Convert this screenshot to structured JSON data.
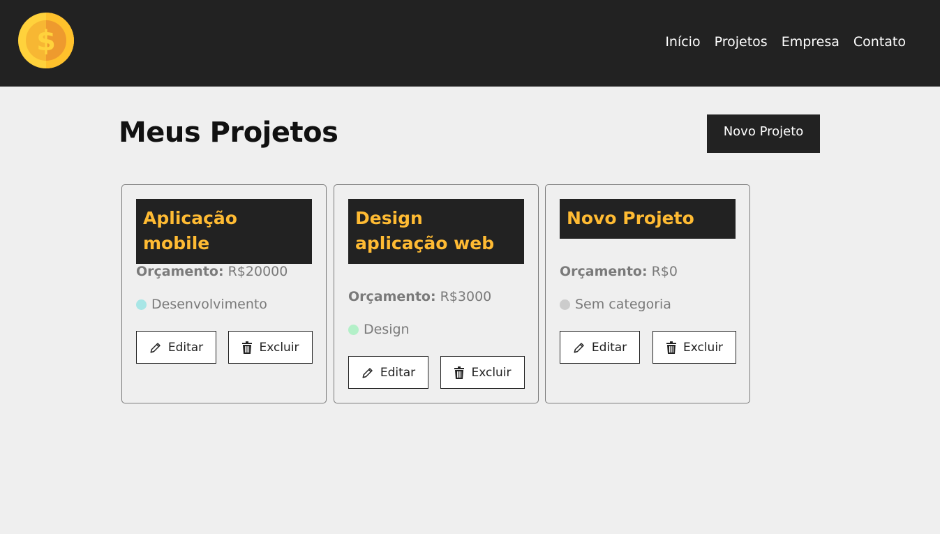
{
  "navbar": {
    "links": [
      "Início",
      "Projetos",
      "Empresa",
      "Contato"
    ]
  },
  "main": {
    "title": "Meus Projetos",
    "new_project_label": "Novo Projeto"
  },
  "projects": [
    {
      "name": "Aplicação mobile",
      "budget_label": "Orçamento:",
      "budget_value": "R$20000",
      "category": "Desenvolvimento",
      "category_color": "#a8e6e6",
      "edit_label": "Editar",
      "delete_label": "Excluir"
    },
    {
      "name": "Design aplicação web",
      "budget_label": "Orçamento:",
      "budget_value": "R$3000",
      "category": "Design",
      "category_color": "#b3f0c8",
      "edit_label": "Editar",
      "delete_label": "Excluir"
    },
    {
      "name": "Novo Projeto",
      "budget_label": "Orçamento:",
      "budget_value": "R$0",
      "category": "Sem categoria",
      "category_color": "#cccccc",
      "edit_label": "Editar",
      "delete_label": "Excluir"
    }
  ],
  "icons": {
    "logo": "coin-dollar-icon",
    "edit": "pencil-icon",
    "delete": "trash-icon"
  },
  "colors": {
    "navbar_bg": "#222222",
    "accent": "#ffbb33",
    "page_bg": "#efefef"
  }
}
